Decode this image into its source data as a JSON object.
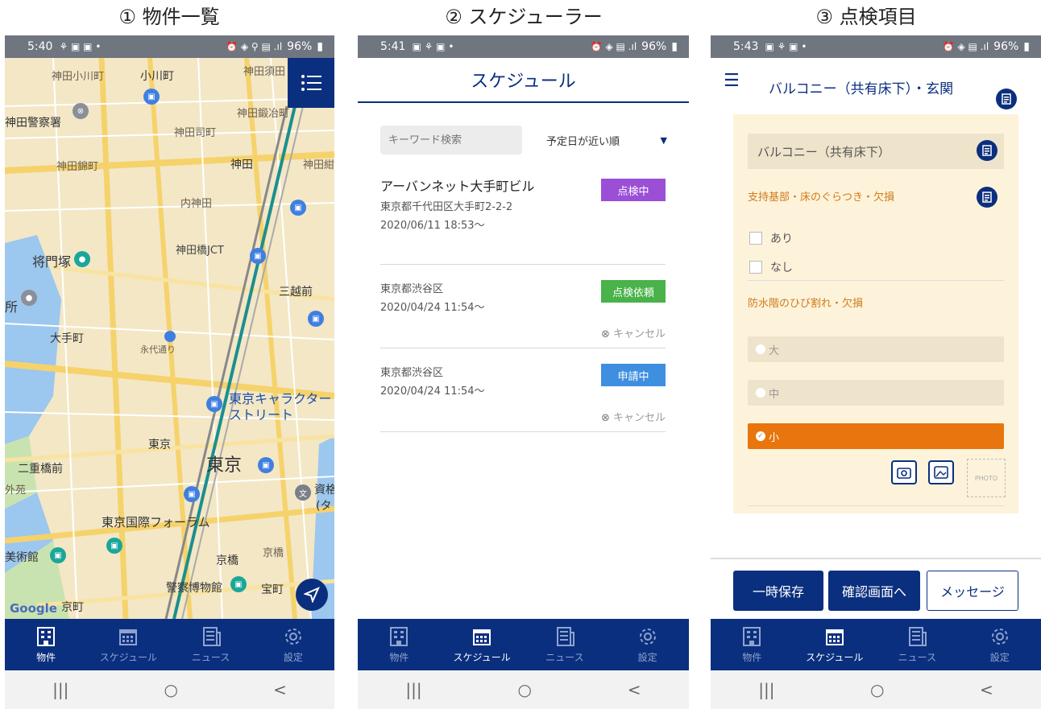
{
  "captions": {
    "c1": "① 物件一覧",
    "c2": "② スケジューラー",
    "c3": "③ 点検項目"
  },
  "phone1": {
    "status": {
      "time": "5:40",
      "battery": "96%"
    },
    "map_labels": [
      "神田小川町",
      "小川町",
      "神田須田",
      "神田鍛冶町",
      "神田警察署",
      "神田司町",
      "神田錦町",
      "神田",
      "神田紺",
      "内神田",
      "神田橋JCT",
      "将門塚",
      "三越前",
      "所",
      "大手町",
      "永代通り",
      "東京キャラクター",
      "ストリート",
      "東京",
      "東京",
      "二重橋前",
      "外苑",
      "資格",
      "(タ",
      "東京国際フォーラム",
      "美術館",
      "京橋",
      "京橋",
      "警察博物館",
      "宝町",
      "京町"
    ],
    "google": "Google"
  },
  "phone2": {
    "status": {
      "time": "5:41",
      "battery": "96%"
    },
    "title": "スケジュール",
    "search_placeholder": "キーワード検索",
    "sort_label": "予定日が近い順",
    "items": [
      {
        "title": "アーバンネット大手町ビル",
        "address": "東京都千代田区大手町2-2-2",
        "date": "2020/06/11 18:53〜",
        "badge": "点検中",
        "badge_color": "#9b4fd6"
      },
      {
        "address": "東京都渋谷区",
        "date": "2020/04/24 11:54〜",
        "badge": "点検依頼",
        "badge_color": "#49b24a",
        "cancel": "キャンセル"
      },
      {
        "address": "東京都渋谷区",
        "date": "2020/04/24 11:54〜",
        "badge": "申請中",
        "badge_color": "#3f8fe0",
        "cancel": "キャンセル"
      }
    ]
  },
  "phone3": {
    "status": {
      "time": "5:43",
      "battery": "96%"
    },
    "title": "バルコニー（共有床下）・玄関",
    "section": "バルコニー（共有床下）",
    "q1": "支持基部・床のぐらつき・欠損",
    "q1_options": [
      "あり",
      "なし"
    ],
    "q2": "防水階のひび割れ・欠損",
    "q2_options": [
      "大",
      "中",
      "小"
    ],
    "q2_selected": "小",
    "photo_placeholder": "PHOTO",
    "buttons": {
      "save": "一時保存",
      "confirm": "確認画面へ",
      "message": "メッセージ"
    }
  },
  "nav": {
    "property": "物件",
    "schedule": "スケジュール",
    "news": "ニュース",
    "settings": "設定"
  },
  "sys": {
    "back": "<",
    "home": "○",
    "recent": "|||"
  },
  "colors": {
    "navy": "#0b2f7f",
    "orange": "#e8750d",
    "map_bg": "#f3e7c6",
    "panel_bg": "#fdf3da"
  }
}
